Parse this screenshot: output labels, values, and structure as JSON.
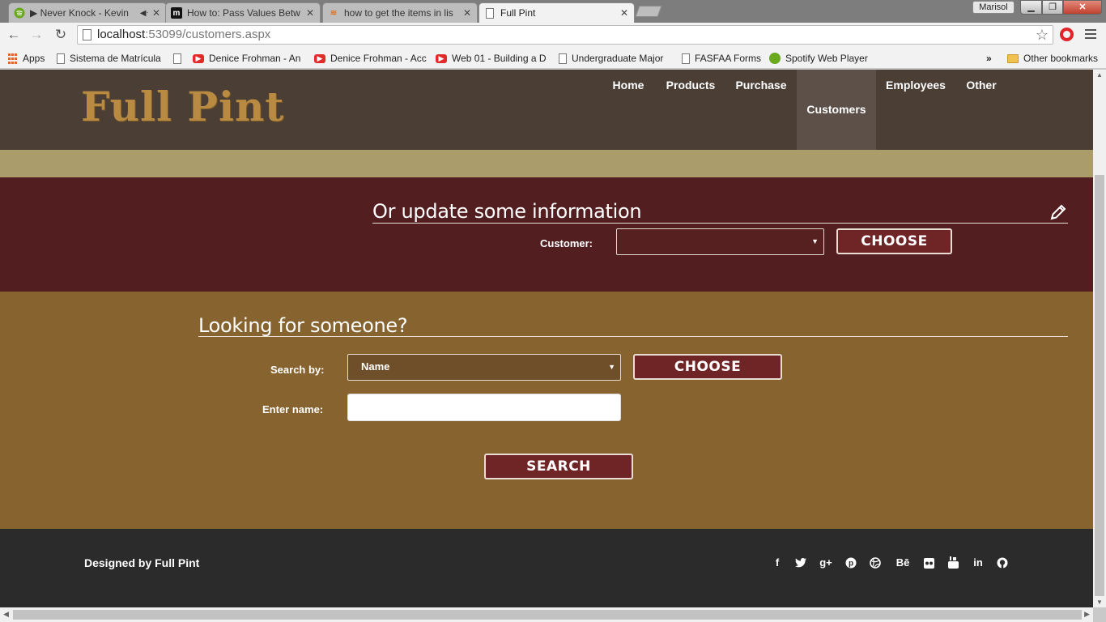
{
  "browser": {
    "tabs": [
      {
        "title": "▶ Never Knock - Kevin",
        "icon": "spotify-icon"
      },
      {
        "title": "How to: Pass Values Betw",
        "icon": "m-icon"
      },
      {
        "title": "how to get the items in lis",
        "icon": "stack-icon"
      },
      {
        "title": "Full Pint",
        "icon": "page-icon"
      }
    ],
    "profile_name": "Marisol",
    "url_host": "localhost",
    "url_path": ":53099/customers.aspx",
    "bookmarks": [
      {
        "label": "Apps",
        "icon": "apps-icon"
      },
      {
        "label": "Sistema de Matrícula",
        "icon": "page-icon"
      },
      {
        "label": "",
        "icon": "page-icon"
      },
      {
        "label": "Denice Frohman - An",
        "icon": "youtube-icon"
      },
      {
        "label": "Denice Frohman - Acc",
        "icon": "youtube-icon"
      },
      {
        "label": "Web 01 - Building a D",
        "icon": "youtube-icon"
      },
      {
        "label": "Undergraduate Major",
        "icon": "page-icon"
      },
      {
        "label": "FASFAA Forms",
        "icon": "page-icon"
      },
      {
        "label": "Spotify Web Player",
        "icon": "spotify-icon"
      }
    ],
    "more_bookmarks": "»",
    "other_bookmarks": "Other bookmarks"
  },
  "site": {
    "logo": "Full Pint",
    "nav": [
      {
        "label": "Home"
      },
      {
        "label": "Products"
      },
      {
        "label": "Purchase"
      },
      {
        "label": "Customers",
        "active": true
      },
      {
        "label": "Employees"
      },
      {
        "label": "Other"
      }
    ]
  },
  "update_section": {
    "title": "Or update some information",
    "icon": "pencil-icon",
    "customer_label": "Customer:",
    "customer_value": "",
    "choose_button": "CHOOSE"
  },
  "search_section": {
    "title": "Looking for someone?",
    "search_by_label": "Search by:",
    "search_by_value": "Name",
    "choose_button": "CHOOSE",
    "name_label": "Enter name:",
    "name_value": "",
    "search_button": "SEARCH"
  },
  "footer": {
    "credit": "Designed by Full Pint",
    "social": [
      {
        "icon": "facebook-icon",
        "glyph": "f"
      },
      {
        "icon": "twitter-icon",
        "glyph": "🐦"
      },
      {
        "icon": "google-plus-icon",
        "glyph": "g+"
      },
      {
        "icon": "pinterest-icon",
        "glyph": "℗"
      },
      {
        "icon": "dribbble-icon",
        "glyph": "◎"
      },
      {
        "icon": "behance-icon",
        "glyph": "Bē"
      },
      {
        "icon": "flickr-icon",
        "glyph": "••"
      },
      {
        "icon": "youtube-icon",
        "glyph": "▶"
      },
      {
        "icon": "linkedin-icon",
        "glyph": "in"
      },
      {
        "icon": "github-icon",
        "glyph": "◉"
      }
    ]
  },
  "colors": {
    "header_bg": "#4b3e35",
    "nav_active_bg": "#5d5048",
    "tan_strip": "#aa9c6b",
    "update_bg": "#521e1f",
    "search_bg": "#86632f",
    "footer_bg": "#2b2b2b",
    "button_bg": "#6f2426",
    "logo_color": "#b98a42"
  }
}
